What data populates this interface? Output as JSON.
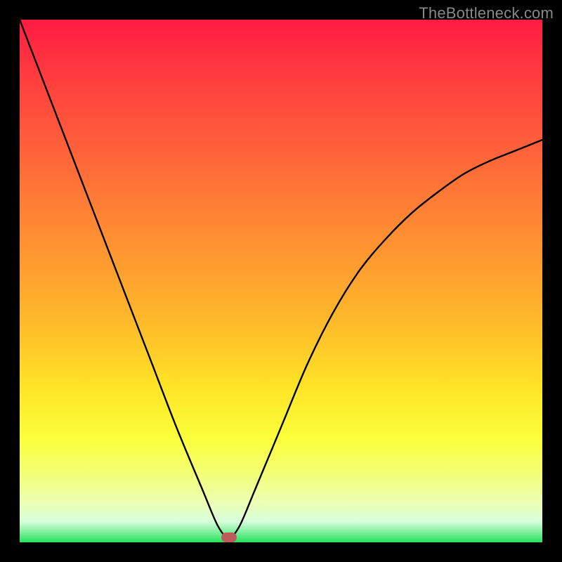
{
  "watermark": "TheBottleneck.com",
  "chart_data": {
    "type": "line",
    "title": "",
    "xlabel": "",
    "ylabel": "",
    "xlim": [
      0,
      100
    ],
    "ylim": [
      0,
      100
    ],
    "grid": false,
    "legend": false,
    "series": [
      {
        "name": "curve",
        "x": [
          0,
          5,
          10,
          15,
          20,
          25,
          30,
          35,
          38,
          40,
          42,
          45,
          50,
          55,
          60,
          65,
          70,
          75,
          80,
          85,
          90,
          95,
          100
        ],
        "values": [
          100,
          87,
          74,
          61,
          48,
          35,
          22,
          10,
          3,
          1,
          3,
          10,
          22,
          34,
          44,
          52,
          58,
          63,
          67,
          70.5,
          73,
          75,
          77
        ]
      }
    ],
    "marker": {
      "x": 40,
      "y": 1
    },
    "background_gradient": {
      "top": "#ff1b43",
      "mid": "#ffe326",
      "bottom": "#27e05e"
    }
  }
}
